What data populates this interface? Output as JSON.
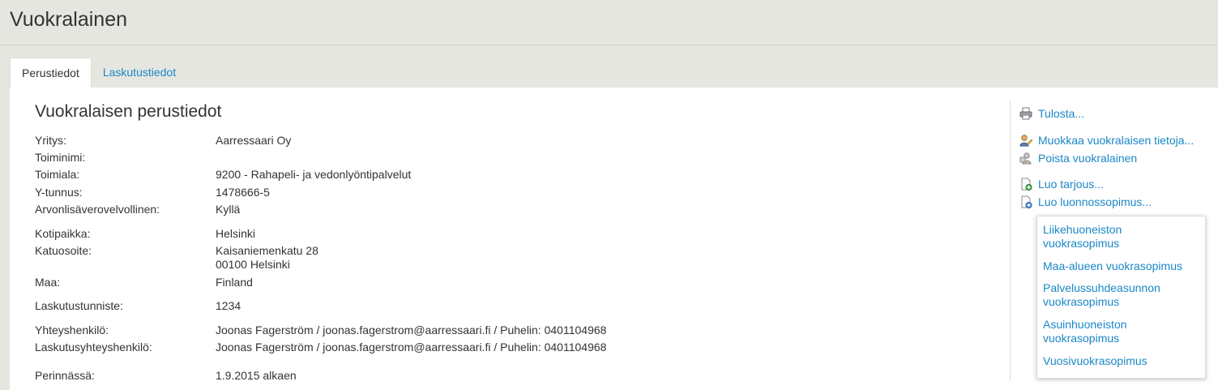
{
  "page": {
    "title": "Vuokralainen"
  },
  "tabs": [
    {
      "label": "Perustiedot",
      "active": true
    },
    {
      "label": "Laskutustiedot",
      "active": false
    }
  ],
  "section": {
    "title": "Vuokralaisen perustiedot"
  },
  "fields": [
    {
      "label": "Yritys:",
      "value": "Aarressaari Oy"
    },
    {
      "label": "Toiminimi:",
      "value": ""
    },
    {
      "label": "Toimiala:",
      "value": "9200 - Rahapeli- ja vedonlyöntipalvelut"
    },
    {
      "label": "Y-tunnus:",
      "value": "1478666-5"
    },
    {
      "label": "Arvonlisäverovelvollinen:",
      "value": "Kyllä"
    },
    {
      "label": "Kotipaikka:",
      "value": "Helsinki"
    },
    {
      "label": "Katuosoite:",
      "value": "Kaisaniemenkatu 28",
      "value2": "00100 Helsinki"
    },
    {
      "label": "Maa:",
      "value": "Finland"
    },
    {
      "label": "Laskutustunniste:",
      "value": "1234"
    },
    {
      "label": "Yhteyshenkilö:",
      "value": "Joonas Fagerström / joonas.fagerstrom@aarressaari.fi / Puhelin: 0401104968"
    },
    {
      "label": "Laskutusyhteyshenkilö:",
      "value": "Joonas Fagerström / joonas.fagerstrom@aarressaari.fi / Puhelin: 0401104968"
    },
    {
      "label": "Perinnässä:",
      "value": "1.9.2015 alkaen"
    }
  ],
  "actions": [
    {
      "label": "Tulosta...",
      "icon": "printer-icon"
    },
    {
      "label": "Muokkaa vuokralaisen tietoja...",
      "icon": "edit-person-icon"
    },
    {
      "label": "Poista vuokralainen",
      "icon": "delete-person-icon"
    },
    {
      "label": "Luo tarjous...",
      "icon": "new-document-icon"
    },
    {
      "label": "Luo luonnossopimus...",
      "icon": "new-contract-icon"
    }
  ],
  "contract_types": [
    "Liikehuoneiston vuokrasopimus",
    "Maa-alueen vuokrasopimus",
    "Palvelussuhdeasunnon vuokrasopimus",
    "Asuinhuoneiston vuokrasopimus",
    "Vuosivuokrasopimus"
  ],
  "colors": {
    "link": "#1a87c7",
    "background": "#e6e6e1",
    "panel": "#ffffff"
  }
}
